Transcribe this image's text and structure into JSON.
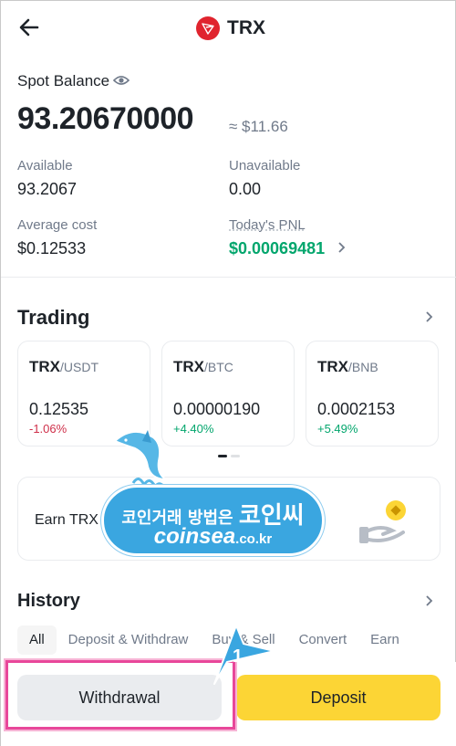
{
  "header": {
    "title": "TRX"
  },
  "balance": {
    "spot_label": "Spot Balance",
    "total": "93.20670000",
    "approx_usd": "≈ $11.66",
    "available_label": "Available",
    "available_value": "93.2067",
    "unavailable_label": "Unavailable",
    "unavailable_value": "0.00",
    "avg_cost_label": "Average cost",
    "avg_cost_value": "$0.12533",
    "pnl_label": "Today's PNL",
    "pnl_value": "$0.00069481"
  },
  "trading": {
    "title": "Trading",
    "pairs": [
      {
        "base": "TRX",
        "quote": "/USDT",
        "price": "0.12535",
        "change": "-1.06%"
      },
      {
        "base": "TRX",
        "quote": "/BTC",
        "price": "0.00000190",
        "change": "+4.40%"
      },
      {
        "base": "TRX",
        "quote": "/BNB",
        "price": "0.0002153",
        "change": "+5.49%"
      }
    ]
  },
  "earn": {
    "label": "Earn TRX"
  },
  "watermark": {
    "line1": "코인거래 방법은",
    "brand_ko": "코인씨",
    "brand_en": "coinsea",
    "domain": ".co.kr"
  },
  "history": {
    "title": "History",
    "tabs": [
      "All",
      "Deposit & Withdraw",
      "Buy & Sell",
      "Convert",
      "Earn"
    ]
  },
  "actions": {
    "withdraw": "Withdrawal",
    "deposit": "Deposit"
  },
  "annotation": {
    "step": "1"
  },
  "colors": {
    "accent": "#fcd535",
    "positive": "#03a66d",
    "negative": "#cf304a",
    "highlight": "#e8479a",
    "callout": "#3aa6e0",
    "trx": "#e0242e"
  },
  "icons": {
    "back": "arrow-left-icon",
    "eye": "eye-icon",
    "chevron": "chevron-right-icon",
    "logo": "trx-logo-icon"
  }
}
